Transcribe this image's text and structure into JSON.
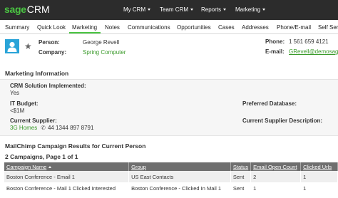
{
  "app": {
    "logo_sage": "sage",
    "logo_crm": "CRM"
  },
  "topnav": {
    "items": [
      {
        "label": "My CRM"
      },
      {
        "label": "Team CRM"
      },
      {
        "label": "Reports"
      },
      {
        "label": "Marketing"
      }
    ]
  },
  "tabs": {
    "items": [
      {
        "label": "Summary"
      },
      {
        "label": "Quick Look"
      },
      {
        "label": "Marketing"
      },
      {
        "label": "Notes"
      },
      {
        "label": "Communications"
      },
      {
        "label": "Opportunities"
      },
      {
        "label": "Cases"
      },
      {
        "label": "Addresses"
      },
      {
        "label": "Phone/E-mail"
      },
      {
        "label": "Self Serv"
      }
    ],
    "active": "Marketing"
  },
  "entity": {
    "person_label": "Person:",
    "person_value": "George Revell",
    "company_label": "Company:",
    "company_value": "Spring Computer",
    "phone_label": "Phone:",
    "phone_value": "1 561 659 4121",
    "email_label": "E-mail:",
    "email_value": "GRevell@demosagecr"
  },
  "marketing_info": {
    "title": "Marketing Information",
    "solution_label": "CRM Solution Implemented:",
    "solution_value": "Yes",
    "budget_label": "IT Budget:",
    "budget_value": "<$1M",
    "preferred_db_label": "Preferred Database:",
    "current_supplier_label": "Current Supplier:",
    "current_supplier_value": "3G Homes",
    "current_supplier_phone": "44 1344 897 8791",
    "supplier_desc_label": "Current Supplier Description:"
  },
  "mailchimp": {
    "title": "MailChimp Campaign Results for Current Person",
    "count_text": "2 Campaigns, Page 1 of 1",
    "columns": [
      "Campaign Name",
      "Group",
      "Status",
      "Email Open Count",
      "Clicked Urls"
    ],
    "rows": [
      [
        "Boston Conference - Email 1",
        "US East Contacts",
        "Sent",
        "2",
        "1"
      ],
      [
        "Boston Conference - Mail 1 Clicked Interested",
        "Boston Conference - Clicked In Mail 1",
        "Sent",
        "1",
        "1"
      ]
    ]
  },
  "colors": {
    "topbar": "#2c2c2c",
    "brand_green": "#4ac542",
    "avatar_blue": "#2aa4d8",
    "table_header": "#6f6f6f"
  },
  "icons": {
    "avatar": "person-avatar-icon",
    "favorite": "star-icon",
    "phone": "phone-icon"
  }
}
